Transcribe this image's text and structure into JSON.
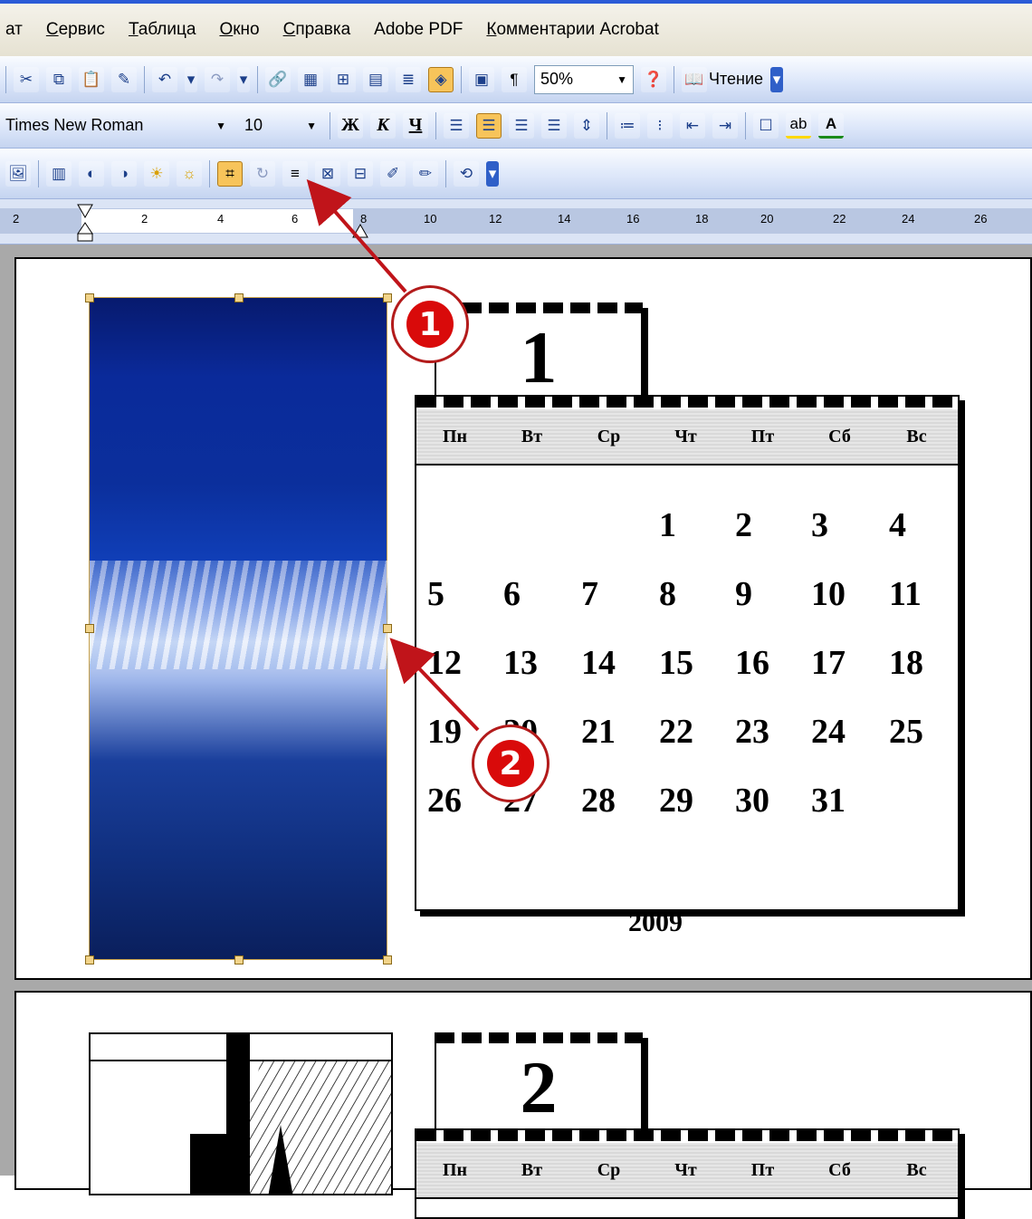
{
  "menu": {
    "items": [
      "ат",
      "Сервис",
      "Таблица",
      "Окно",
      "Справка",
      "Adobe PDF",
      "Комментарии Acrobat"
    ]
  },
  "toolbar_standard": {
    "zoom": "50%",
    "reading_label": "Чтение",
    "icons": [
      "cut-icon",
      "copy-icon",
      "paste-icon",
      "format-painter-icon",
      "undo-icon",
      "redo-icon",
      "hyperlink-icon",
      "tables-borders-icon",
      "insert-table-icon",
      "insert-excel-icon",
      "columns-icon",
      "drawing-icon",
      "document-map-icon",
      "show-formatting-icon",
      "help-icon",
      "read-icon"
    ]
  },
  "toolbar_formatting": {
    "font": "Times New Roman",
    "size": "10",
    "bold": "Ж",
    "italic": "К",
    "underline": "Ч"
  },
  "toolbar_picture": {
    "icons": [
      "insert-picture-icon",
      "color-icon",
      "more-contrast-icon",
      "less-contrast-icon",
      "more-brightness-icon",
      "less-brightness-icon",
      "crop-icon",
      "rotate-icon",
      "line-style-icon",
      "compress-icon",
      "text-wrapping-icon",
      "format-picture-icon",
      "set-transparent-icon",
      "reset-picture-icon"
    ]
  },
  "ruler": {
    "labels": [
      "2",
      "2",
      "4",
      "6",
      "8",
      "10",
      "12",
      "14",
      "16",
      "18",
      "20",
      "22",
      "24",
      "26"
    ]
  },
  "calendar1": {
    "month": "1",
    "days": [
      "Пн",
      "Вт",
      "Ср",
      "Чт",
      "Пт",
      "Сб",
      "Вс"
    ],
    "weeks": [
      [
        "",
        "",
        "",
        "1",
        "2",
        "3",
        "4"
      ],
      [
        "5",
        "6",
        "7",
        "8",
        "9",
        "10",
        "11"
      ],
      [
        "12",
        "13",
        "14",
        "15",
        "16",
        "17",
        "18"
      ],
      [
        "19",
        "20",
        "21",
        "22",
        "23",
        "24",
        "25"
      ],
      [
        "26",
        "27",
        "28",
        "29",
        "30",
        "31",
        ""
      ]
    ],
    "year": "2009"
  },
  "calendar2": {
    "month": "2",
    "days": [
      "Пн",
      "Вт",
      "Ср",
      "Чт",
      "Пт",
      "Сб",
      "Вс"
    ]
  },
  "callouts": [
    "1",
    "2"
  ],
  "colors": {
    "toolbar_gradient_top": "#fafcff",
    "toolbar_gradient_bottom": "#c5d4f0",
    "active_button": "#f7c45a",
    "callout_red": "#d90a0a",
    "arrow_red": "#c0141a"
  }
}
